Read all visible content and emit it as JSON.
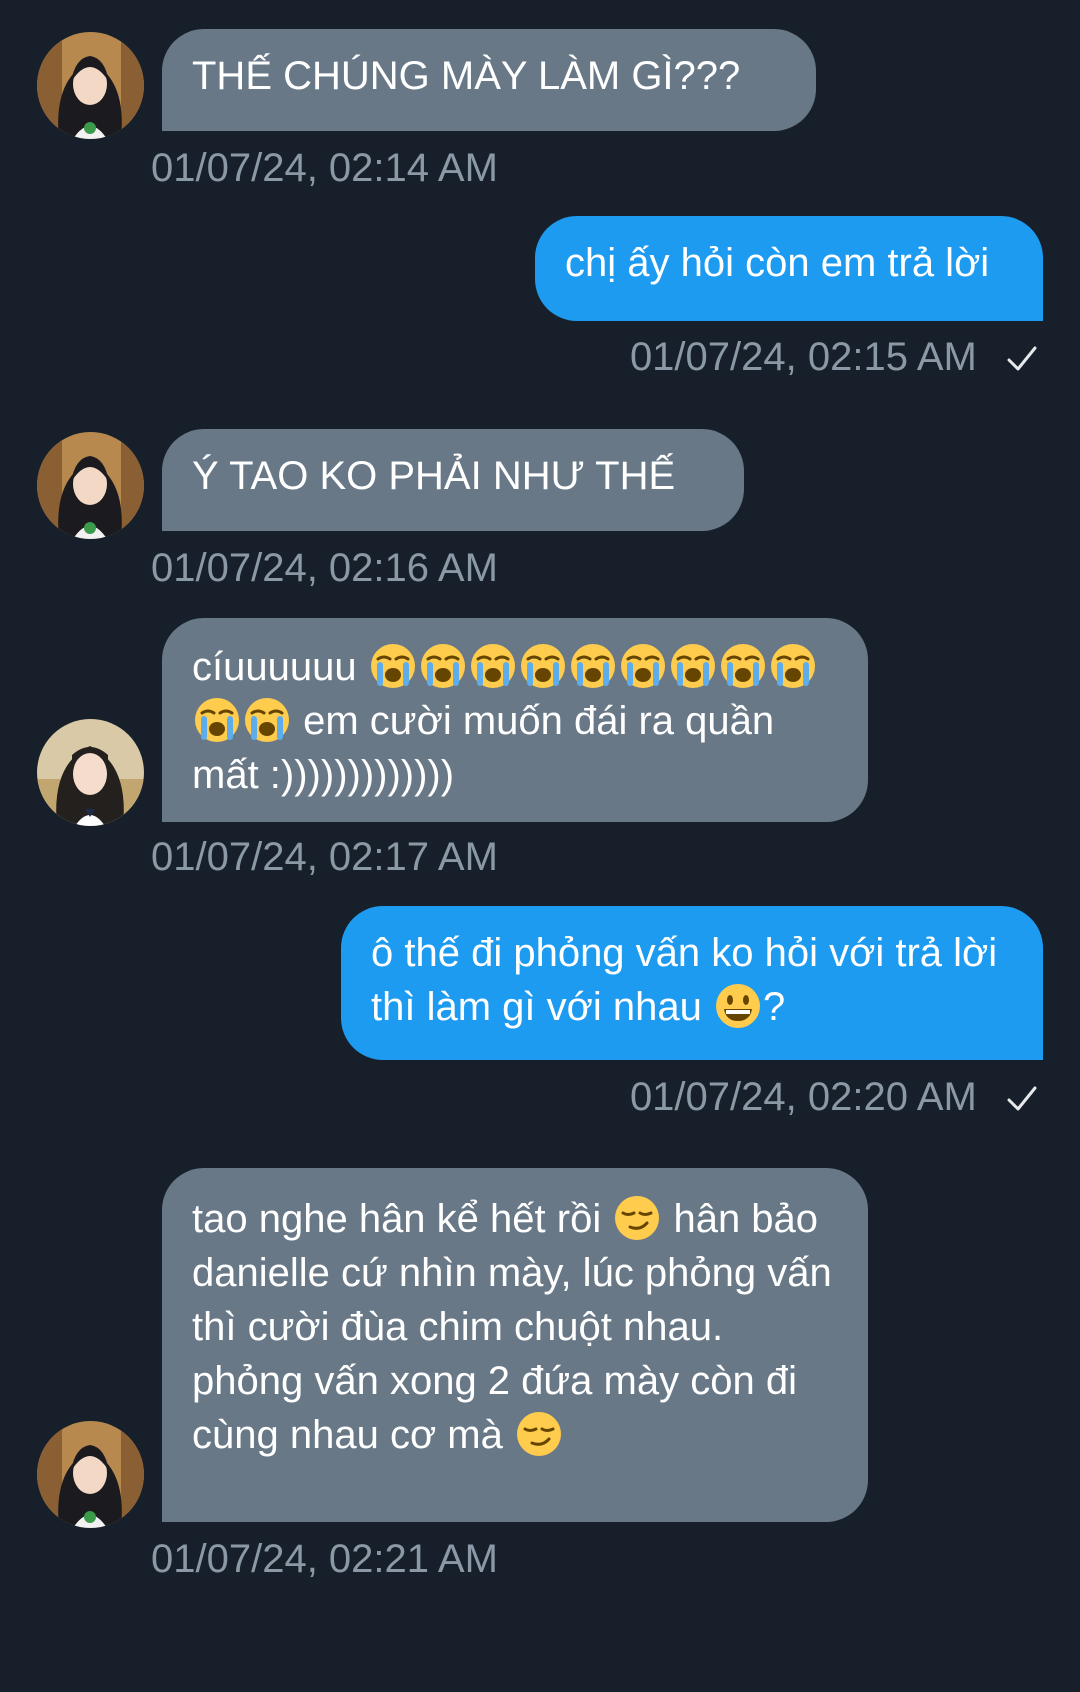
{
  "messages": [
    {
      "text": "THẾ CHÚNG MÀY LÀM GÌ???",
      "time": "01/07/24, 02:14 AM"
    },
    {
      "text": "chị ấy hỏi còn em trả lời",
      "time": "01/07/24, 02:15 AM"
    },
    {
      "text": "Ý TAO KO PHẢI NHƯ THẾ",
      "time": "01/07/24, 02:16 AM"
    },
    {
      "text_a": "cíuuuuuu",
      "text_b": "em cười muốn đái ra quần mất :)))))))))))))",
      "time": "01/07/24, 02:17 AM"
    },
    {
      "text": "ô thế đi phỏng vấn ko hỏi với trả lời thì làm gì với nhau",
      "text_end": "?",
      "time": "01/07/24, 02:20 AM"
    },
    {
      "text_a": "tao nghe hân kể hết rồi",
      "text_b": "hân bảo danielle cứ nhìn mày, lúc phỏng vấn thì cười đùa chim chuột nhau. phỏng vấn xong 2 đứa mày còn đi cùng nhau cơ mà",
      "time": "01/07/24, 02:21 AM"
    }
  ],
  "icons": {
    "loudly_crying": "loudly-crying-emoji",
    "grinning": "grinning-emoji",
    "smirk": "smirking-emoji",
    "read_check": "check-icon"
  },
  "colors": {
    "background": "#17202a",
    "incoming_bubble": "#687887",
    "outgoing_bubble": "#1d9bf0",
    "timestamp": "#8b98a5"
  }
}
